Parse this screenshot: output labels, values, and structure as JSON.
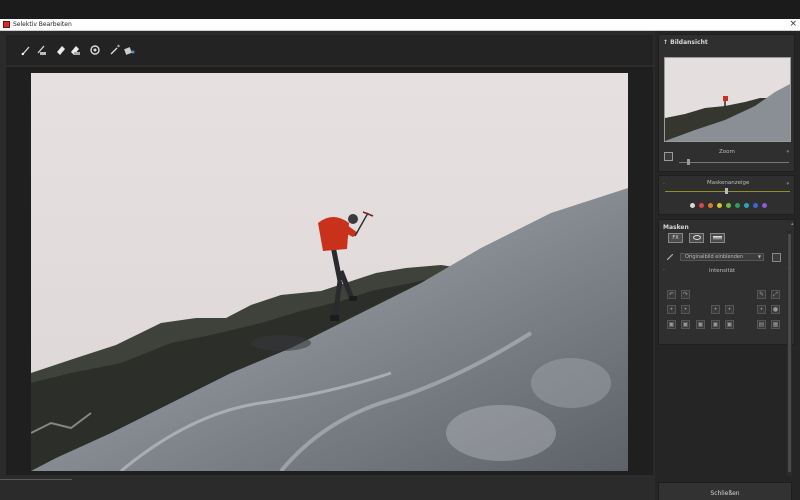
{
  "window": {
    "title": "Selektiv Bearbeiten",
    "app_icon": "app-logo-icon"
  },
  "toolbar": {
    "tools": [
      {
        "name": "brush-icon"
      },
      {
        "name": "brush-plus-icon"
      },
      {
        "name": "eraser-icon"
      },
      {
        "name": "eraser-fill-icon"
      },
      {
        "name": "gradient-reset-icon"
      },
      {
        "name": "magic-wand-icon"
      },
      {
        "name": "fill-bucket-icon"
      }
    ]
  },
  "overview": {
    "title": "Bildansicht",
    "zoom_label": "Zoom",
    "zoom_level": 0.07
  },
  "mask_view": {
    "title": "Maskenanzeige",
    "colors": [
      "#d8d8d8",
      "#e04545",
      "#e07a2a",
      "#d6c52b",
      "#6fbf3a",
      "#2e9e5f",
      "#2aa6b6",
      "#3d63d8",
      "#8c5ad8"
    ]
  },
  "masks": {
    "title": "Masken",
    "fx_label": "FX",
    "dropdown_value": "Originalbild einblenden",
    "intensity_label": "Intensität"
  },
  "footer": {
    "close_label": "Schließen"
  },
  "accent_colors": {
    "climber_jacket": "#c8321c",
    "mask_track": "#8f8f2a"
  }
}
